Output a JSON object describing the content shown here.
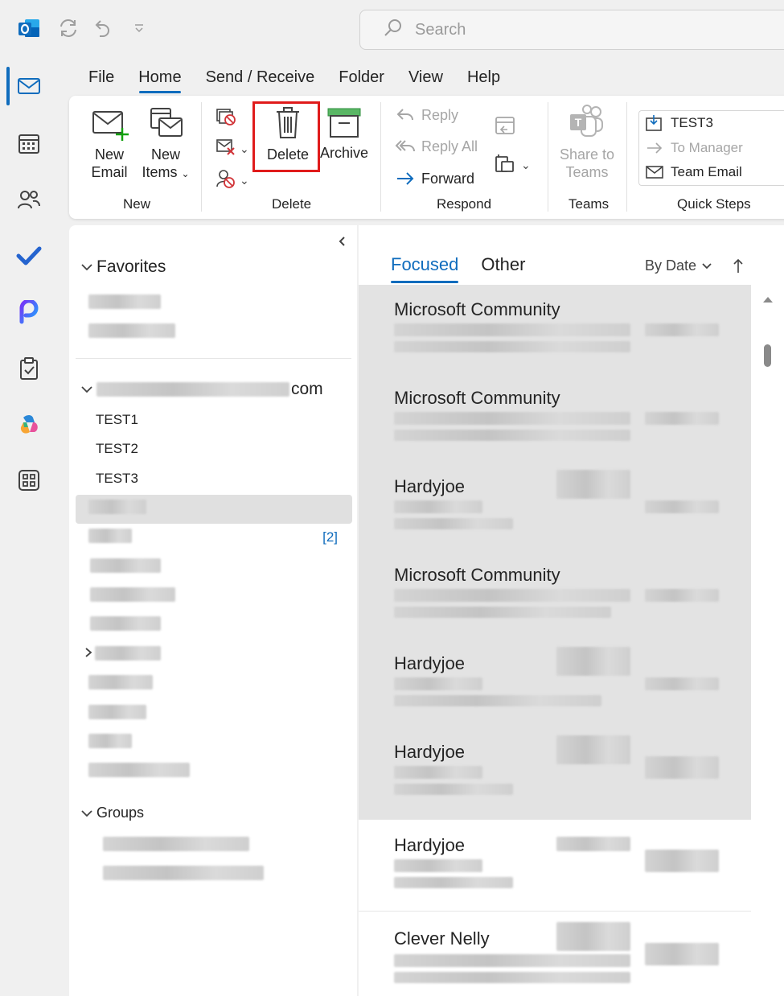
{
  "title_bar": {
    "search_placeholder": "Search"
  },
  "menu": {
    "tabs": [
      "File",
      "Home",
      "Send / Receive",
      "Folder",
      "View",
      "Help"
    ],
    "active": "Home"
  },
  "ribbon": {
    "groups": {
      "new": {
        "label": "New",
        "new_email": [
          "New",
          "Email"
        ],
        "new_items": [
          "New",
          "Items"
        ]
      },
      "delete": {
        "label": "Delete",
        "delete": "Delete",
        "archive": "Archive"
      },
      "respond": {
        "label": "Respond",
        "reply": "Reply",
        "reply_all": "Reply All",
        "forward": "Forward"
      },
      "teams": {
        "label": "Teams",
        "share": [
          "Share to",
          "Teams"
        ]
      },
      "quick_steps": {
        "label": "Quick Steps",
        "items": [
          "TEST3",
          "To Manager",
          "Team Email"
        ]
      }
    },
    "highlight_color": "#e01b1b"
  },
  "folder_pane": {
    "favorites_label": "Favorites",
    "account_suffix": "com",
    "folders": [
      "TEST1",
      "TEST2",
      "TEST3"
    ],
    "unread_count": "[2]",
    "groups_label": "Groups"
  },
  "message_list": {
    "tabs": [
      "Focused",
      "Other"
    ],
    "active_tab": "Focused",
    "sort_label": "By Date",
    "messages": [
      {
        "sender": "Microsoft Community"
      },
      {
        "sender": "Microsoft Community"
      },
      {
        "sender": "Hardyjoe"
      },
      {
        "sender": "Microsoft Community"
      },
      {
        "sender": "Hardyjoe"
      },
      {
        "sender": "Hardyjoe"
      },
      {
        "sender": "Hardyjoe"
      },
      {
        "sender": "Clever Nelly"
      }
    ]
  },
  "colors": {
    "accent": "#0f6cbd",
    "highlight": "#e01b1b"
  }
}
